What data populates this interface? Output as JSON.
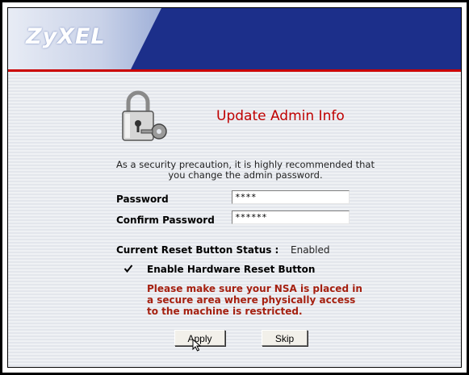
{
  "header": {
    "logo": "ZyXEL"
  },
  "page": {
    "title": "Update Admin Info",
    "intro_line1": "As a security precaution, it is highly recommended that",
    "intro_line2": "you change the admin password."
  },
  "form": {
    "password_label": "Password",
    "password_value": "****",
    "confirm_label": "Confirm Password",
    "confirm_value": "******"
  },
  "reset": {
    "status_label": "Current Reset Button Status :",
    "status_value": "Enabled",
    "checkbox_label": "Enable Hardware Reset Button",
    "checkbox_checked": true,
    "warning_line1": "Please make sure your NSA is placed in",
    "warning_line2": "a secure area where physically access",
    "warning_line3": "to the machine is restricted."
  },
  "buttons": {
    "apply": "Apply",
    "skip": "Skip"
  },
  "colors": {
    "header_blue": "#1c2f8a",
    "accent_red": "#c00000",
    "warning_text": "#a52010"
  },
  "icons": {
    "lock": "padlock-with-key-icon",
    "checkmark": "checkmark-icon",
    "pointer": "mouse-pointer-icon"
  }
}
